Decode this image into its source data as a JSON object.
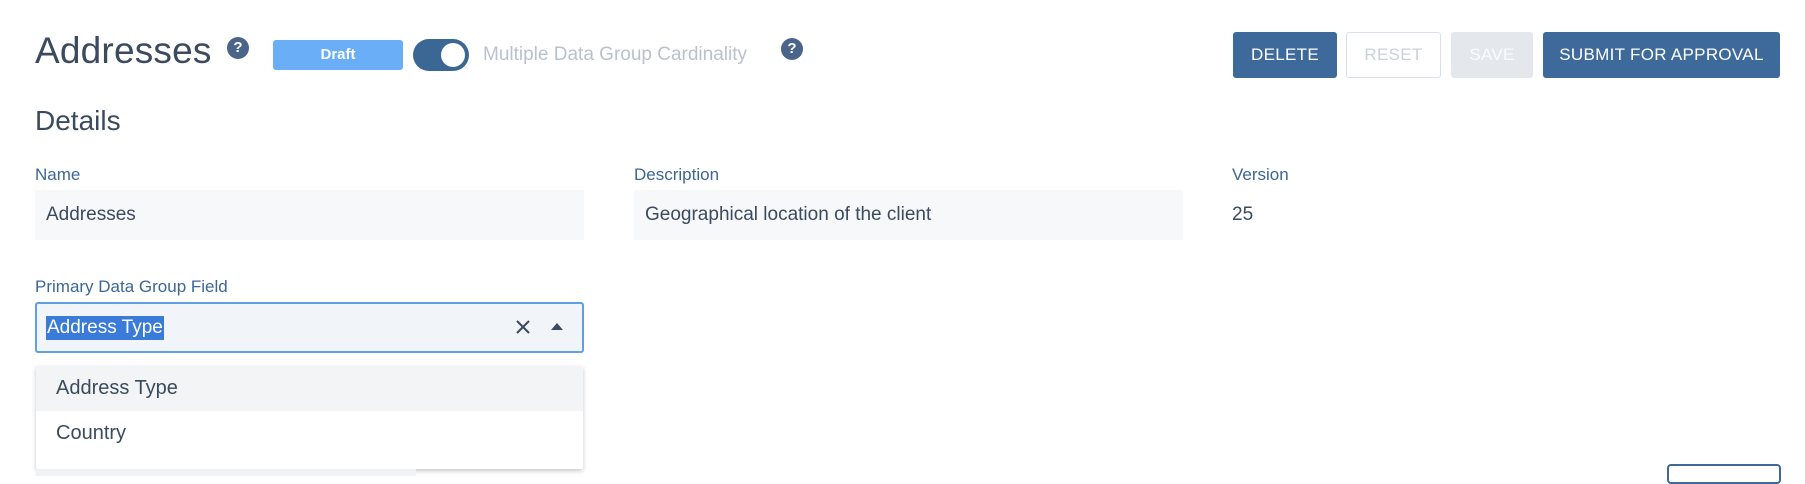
{
  "header": {
    "title": "Addresses",
    "status": "Draft",
    "toggle_label": "Multiple Data Group Cardinality",
    "toggle_on": true
  },
  "toolbar": {
    "delete_label": "DELETE",
    "reset_label": "RESET",
    "save_label": "SAVE",
    "submit_label": "SUBMIT FOR APPROVAL"
  },
  "details": {
    "section_title": "Details",
    "name_label": "Name",
    "name_value": "Addresses",
    "description_label": "Description",
    "description_value": "Geographical location of the client",
    "version_label": "Version",
    "version_value": "25",
    "primary_label": "Primary Data Group Field",
    "primary_value": "Address Type"
  },
  "dropdown": {
    "options": [
      "Address Type",
      "Country"
    ],
    "highlighted": "Address Type"
  },
  "icons": {
    "help": "help-icon",
    "clear": "close-icon",
    "caret": "caret-up-icon"
  },
  "colors": {
    "primary": "#3e6a9b",
    "draft_badge": "#6aaef7",
    "focus_border": "#5fa0e5",
    "label": "#3b6794"
  }
}
